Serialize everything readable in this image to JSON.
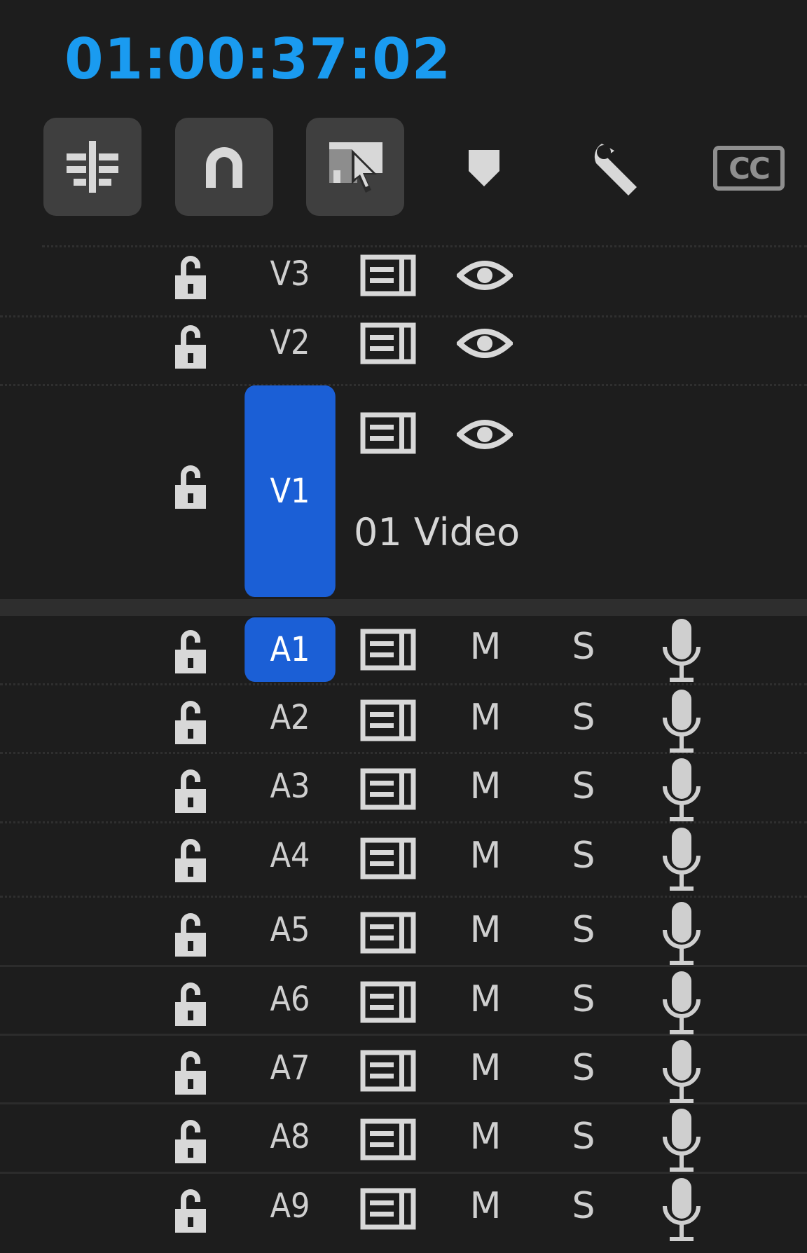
{
  "timecode": "01:00:37:02",
  "toolbar": {
    "buttons": [
      {
        "icon": "insert-overwrite-sequences-icon"
      },
      {
        "icon": "snap-magnet-icon"
      },
      {
        "icon": "linked-selection-icon"
      },
      {
        "icon": "add-marker-icon"
      },
      {
        "icon": "wrench-settings-icon"
      },
      {
        "icon": "captions-cc-icon",
        "label": "CC"
      }
    ]
  },
  "video_tracks": [
    {
      "name": "V3",
      "selected": false
    },
    {
      "name": "V2",
      "selected": false
    },
    {
      "name": "V1",
      "selected": true,
      "clip_name": "01 Video"
    }
  ],
  "audio_tracks": [
    {
      "name": "A1",
      "selected": true,
      "mute": "M",
      "solo": "S"
    },
    {
      "name": "A2",
      "selected": false,
      "mute": "M",
      "solo": "S"
    },
    {
      "name": "A3",
      "selected": false,
      "mute": "M",
      "solo": "S"
    },
    {
      "name": "A4",
      "selected": false,
      "mute": "M",
      "solo": "S"
    },
    {
      "name": "A5",
      "selected": false,
      "mute": "M",
      "solo": "S"
    },
    {
      "name": "A6",
      "selected": false,
      "mute": "M",
      "solo": "S"
    },
    {
      "name": "A7",
      "selected": false,
      "mute": "M",
      "solo": "S"
    },
    {
      "name": "A8",
      "selected": false,
      "mute": "M",
      "solo": "S"
    },
    {
      "name": "A9",
      "selected": false,
      "mute": "M",
      "solo": "S"
    }
  ],
  "colors": {
    "accent": "#1a9bf0",
    "selection": "#1b5fd6",
    "background": "#1d1d1d"
  }
}
